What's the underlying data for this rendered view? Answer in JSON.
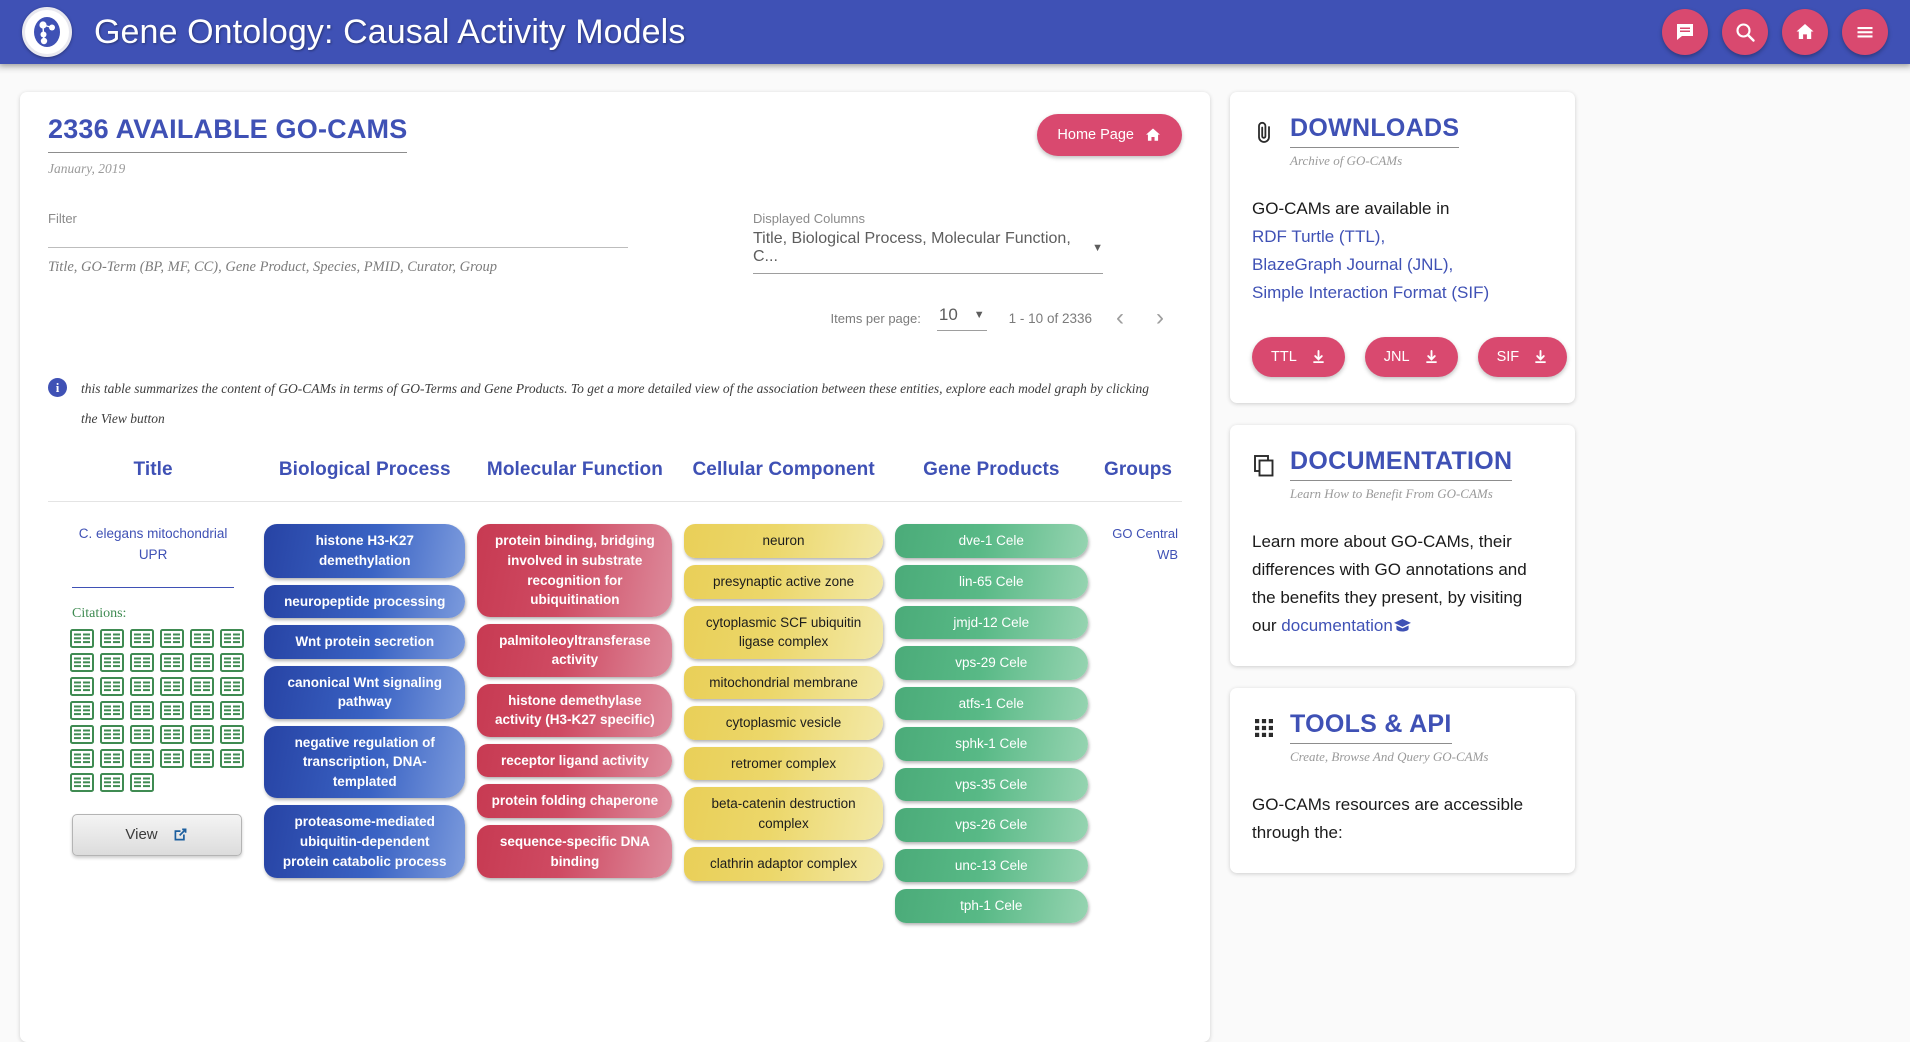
{
  "header": {
    "title": "Gene Ontology: Causal Activity Models",
    "logo_icon": "go-logo-icon",
    "actions": [
      {
        "name": "comment-icon",
        "label": "Comment"
      },
      {
        "name": "search-icon",
        "label": "Search"
      },
      {
        "name": "home-icon",
        "label": "Home"
      },
      {
        "name": "menu-icon",
        "label": "Menu"
      }
    ],
    "accent_color": "#3f51b5",
    "fab_color": "#d9496f"
  },
  "main": {
    "page_title": "2336 AVAILABLE GO-CAMS",
    "page_subtitle": "January, 2019",
    "home_button_label": "Home Page",
    "filter": {
      "label": "Filter",
      "value": "",
      "placeholder": "",
      "hint": "Title, GO-Term (BP, MF, CC), Gene Product, Species, PMID, Curator, Group"
    },
    "displayed_columns": {
      "label": "Displayed Columns",
      "value": "Title, Biological Process, Molecular Function, C..."
    },
    "paginator": {
      "items_per_page_label": "Items per page:",
      "items_per_page_value": "10",
      "range_label": "1 - 10 of 2336",
      "prev_label": "‹",
      "next_label": "›"
    },
    "info_text": "this table summarizes the content of GO-CAMs in terms of GO-Terms and Gene Products. To get a more detailed view of the association between these entities, explore each model graph by clicking the View button",
    "table": {
      "columns": [
        "Title",
        "Biological Process",
        "Molecular Function",
        "Cellular Component",
        "Gene Products",
        "Groups"
      ],
      "row": {
        "title": "C. elegans mitochondrial UPR",
        "citations_label": "Citations:",
        "citation_count": 39,
        "view_label": "View",
        "biological_process": [
          "histone H3-K27 demethylation",
          "neuropeptide processing",
          "Wnt protein secretion",
          "canonical Wnt signaling pathway",
          "negative regulation of transcription, DNA-templated",
          "proteasome-mediated ubiquitin-dependent protein catabolic process"
        ],
        "molecular_function": [
          "protein binding, bridging involved in substrate recognition for ubiquitination",
          "palmitoleoyltransferase activity",
          "histone demethylase activity (H3-K27 specific)",
          "receptor ligand activity",
          "protein folding chaperone",
          "sequence-specific DNA binding"
        ],
        "cellular_component": [
          "neuron",
          "presynaptic active zone",
          "cytoplasmic SCF ubiquitin ligase complex",
          "mitochondrial membrane",
          "cytoplasmic vesicle",
          "retromer complex",
          "beta-catenin destruction complex",
          "clathrin adaptor complex"
        ],
        "gene_products": [
          "dve-1 Cele",
          "lin-65 Cele",
          "jmjd-12 Cele",
          "vps-29 Cele",
          "atfs-1 Cele",
          "sphk-1 Cele",
          "vps-35 Cele",
          "vps-26 Cele",
          "unc-13 Cele",
          "tph-1 Cele"
        ],
        "groups": [
          "GO Central",
          "WB"
        ]
      }
    }
  },
  "sidebar": {
    "downloads": {
      "icon": "paperclip-icon",
      "title": "DOWNLOADS",
      "subtitle": "Archive of GO-CAMs",
      "intro": "GO-CAMs are available in",
      "links": [
        "RDF Turtle (TTL),",
        "BlazeGraph Journal (JNL),",
        "Simple Interaction Format (SIF)"
      ],
      "buttons": [
        "TTL",
        "JNL",
        "SIF"
      ]
    },
    "documentation": {
      "icon": "copy-icon",
      "title": "DOCUMENTATION",
      "subtitle": "Learn How to Benefit From GO-CAMs",
      "body_prefix": "Learn more about GO-CAMs, their differences with GO annotations and the benefits they present, by visiting our ",
      "link_label": "documentation"
    },
    "tools": {
      "icon": "grid-icon",
      "title": "TOOLS & API",
      "subtitle": "Create, Browse And Query GO-CAMs",
      "body": "GO-CAMs resources are accessible through the:"
    }
  }
}
